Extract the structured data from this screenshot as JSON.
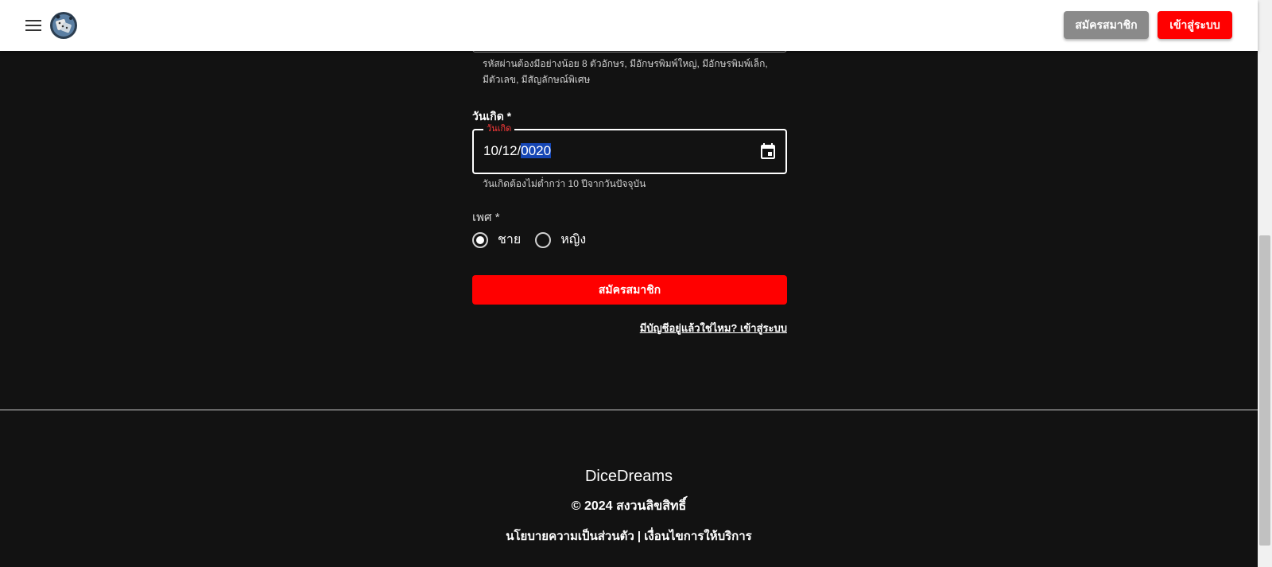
{
  "header": {
    "menu_icon": "hamburger-menu-icon",
    "logo_icon": "dice-logo-icon",
    "register_label": "สมัครสมาชิก",
    "login_label": "เข้าสู่ระบบ"
  },
  "form": {
    "password_helper_line1": "รหัสผ่านต้องมีอย่างน้อย 8 ตัวอักษร, มีอักษรพิมพ์ใหญ่, มีอักษรพิมพ์เล็ก,",
    "password_helper_line2": "มีตัวเลข, มีสัญลักษณ์พิเศษ",
    "birthdate_label": "วันเกิด *",
    "birthdate_floating_label": "วันเกิด",
    "birthdate_value_prefix": "10/12/",
    "birthdate_value_selected": "0020",
    "birthdate_helper": "วันเกิดต้องไม่ต่ำกว่า 10 ปีจากวันปัจจุบัน",
    "gender_label": "เพศ *",
    "gender_options": [
      {
        "label": "ชาย",
        "selected": true
      },
      {
        "label": "หญิง",
        "selected": false
      }
    ],
    "submit_label": "สมัครสมาชิก",
    "login_link": "มีบัญชีอยู่แล้วใช่ไหม? เข้าสู่ระบบ"
  },
  "footer": {
    "brand": "DiceDreams",
    "copyright": "© 2024 สงวนลิขสิทธิ์",
    "privacy": "นโยบายความเป็นส่วนตัว",
    "separator": " | ",
    "terms": "เงื่อนไขการให้บริการ"
  },
  "colors": {
    "background": "#121212",
    "accent": "#ff0000",
    "secondary_button": "#8a8a8a",
    "error_label": "#ff3b3b"
  }
}
